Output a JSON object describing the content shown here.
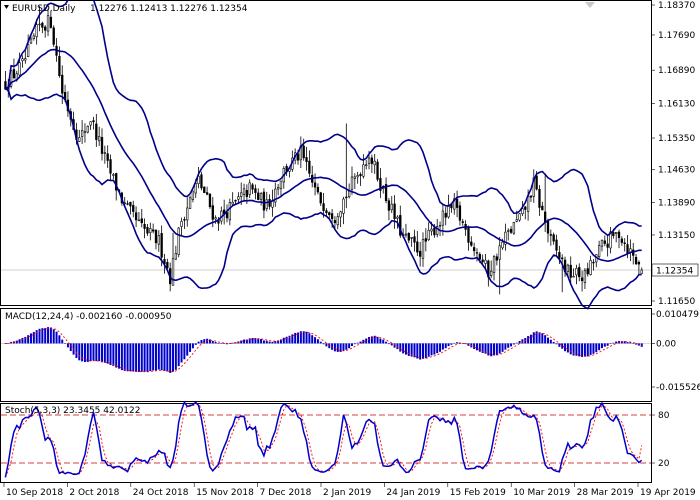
{
  "chart_data": [
    {
      "type": "candlestick",
      "header": {
        "symbol": "EURUSD,Daily",
        "ohlc": "1.12276 1.12413 1.12276 1.12354"
      },
      "last_price_label": "1.12354",
      "y_ticks": [
        "1.18370",
        "1.17690",
        "1.16890",
        "1.16130",
        "1.15350",
        "1.14630",
        "1.13890",
        "1.13150",
        "1.12354",
        "1.11650"
      ],
      "ylim": [
        1.1145,
        1.1845
      ],
      "series": [
        {
          "name": "Bollinger Upper",
          "color": "#00008b"
        },
        {
          "name": "Bollinger Middle",
          "color": "#00008b"
        },
        {
          "name": "Bollinger Lower",
          "color": "#00008b"
        }
      ],
      "candles_note": "daily OHLC from mid-Sep 2018 to 19 Apr 2019"
    },
    {
      "type": "bar",
      "header": {
        "label": "MACD(12,24,4) -0.002160 -0.000950"
      },
      "y_ticks": [
        "0.010479",
        "0.00",
        "-0.015526"
      ],
      "ylim": [
        -0.0165,
        0.0113
      ],
      "series": [
        {
          "name": "MACD",
          "color": "#0000cc"
        },
        {
          "name": "Signal",
          "color": "#ff0000"
        }
      ]
    },
    {
      "type": "line",
      "header": {
        "label": "Stoch(5,3,3) 23.3455 42.0122"
      },
      "y_ticks": [
        "80",
        "20"
      ],
      "levels": [
        80,
        20
      ],
      "ylim": [
        0,
        100
      ],
      "series": [
        {
          "name": "%K",
          "color": "#0000cc"
        },
        {
          "name": "%D",
          "color": "#ff0000"
        }
      ]
    }
  ],
  "x_axis": {
    "labels": [
      "10 Sep 2018",
      "2 Oct 2018",
      "24 Oct 2018",
      "15 Nov 2018",
      "7 Dec 2018",
      "2 Jan 2019",
      "24 Jan 2019",
      "15 Feb 2019",
      "10 Mar 2019",
      "28 Mar 2019",
      "19 Apr 2019"
    ]
  },
  "colors": {
    "candle": "#000000",
    "bands": "#00008b",
    "macd_hist": "#0000cc",
    "signal": "#ff0000",
    "levels": "#cc0000",
    "grid": "#c0c0c0"
  }
}
